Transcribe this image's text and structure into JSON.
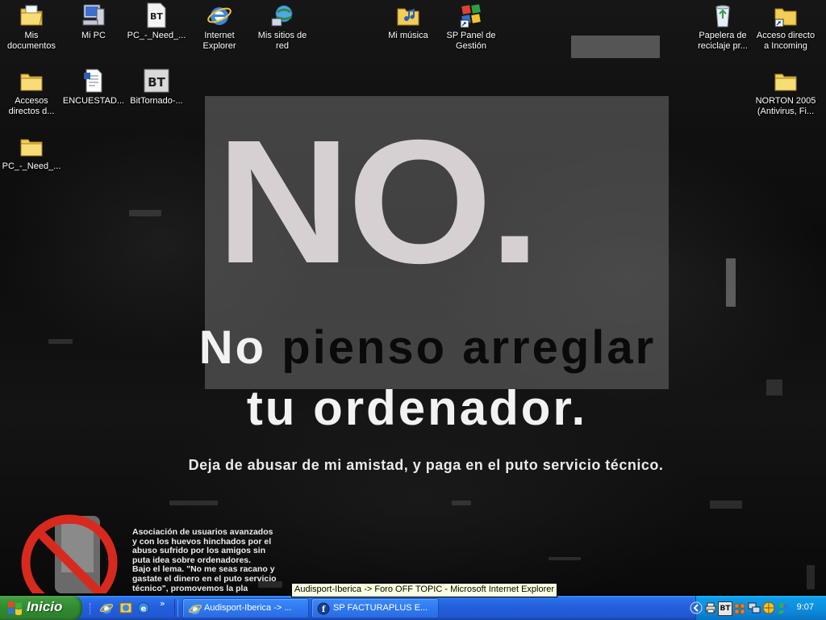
{
  "desktop": {
    "icons": [
      {
        "label": "Mis documentos",
        "icon": "my-documents-icon"
      },
      {
        "label": "Mi PC",
        "icon": "my-computer-icon"
      },
      {
        "label": "PC_-_Need_...",
        "icon": "bt-file-icon"
      },
      {
        "label": "Internet Explorer",
        "icon": "internet-explorer-icon"
      },
      {
        "label": "Mis sitios de red",
        "icon": "network-places-icon"
      },
      {
        "label": "Mi música",
        "icon": "my-music-icon"
      },
      {
        "label": "SP Panel de Gestión",
        "icon": "sp-panel-icon"
      },
      {
        "label": "Papelera de reciclaje pr...",
        "icon": "recycle-bin-icon"
      },
      {
        "label": "Acceso directo a Incoming",
        "icon": "folder-shortcut-icon"
      },
      {
        "label": "Accesos directos d...",
        "icon": "folder-icon"
      },
      {
        "label": "ENCUESTAD...",
        "icon": "document-icon"
      },
      {
        "label": "BitTornado-...",
        "icon": "bittornado-icon"
      },
      {
        "label": "NORTON 2005 (Antivirus, Fi...",
        "icon": "folder-icon"
      },
      {
        "label": "PC_-_Need_...",
        "icon": "folder-icon"
      }
    ]
  },
  "wallpaper": {
    "headline": "NO.",
    "line1_light": "No ",
    "line1_dark": "pienso arreglar",
    "line2": "tu ordenador.",
    "subtitle": "Deja de abusar de mi amistad, y paga en el puto servicio técnico.",
    "assoc_lines": [
      "Asociación de usuarios avanzados",
      " y con los huevos  hinchados por el",
      "abuso sufrido por los amigos sin",
      "puta idea sobre ordenadores.",
      "Bajo el lema. \"No me seas racano y",
      "gastate el dinero en el puto servicio",
      "técnico\",  promovemos la pla"
    ]
  },
  "tooltip": "Audisport-Iberica -> Foro OFF TOPIC - Microsoft Internet Explorer",
  "taskbar": {
    "start_label": "Inicio",
    "quick_launch": [
      "internet-explorer-icon",
      "outlook-express-icon",
      "ie-browser-icon"
    ],
    "overflow": "»",
    "buttons": [
      {
        "label": "Audisport-Iberica -> ...",
        "icon": "internet-explorer-icon"
      },
      {
        "label": "SP FACTURAPLUS E...",
        "icon": "facturaplus-icon"
      }
    ],
    "tray_icons": [
      "chevron-left-icon",
      "printer-icon",
      "bittornado-icon",
      "winamp-icon",
      "network-icon",
      "msn-icon",
      "security-icon"
    ],
    "tray_bt_label": "BT",
    "clock": "9:07"
  },
  "colors": {
    "taskbar_blue": "#245edb",
    "start_green": "#3c9a3c",
    "tray_blue": "#0d8bdb",
    "tooltip_bg": "#ffffe1",
    "panel_gray": "#6e6e6e",
    "headline_color": "#d7d0d3"
  }
}
